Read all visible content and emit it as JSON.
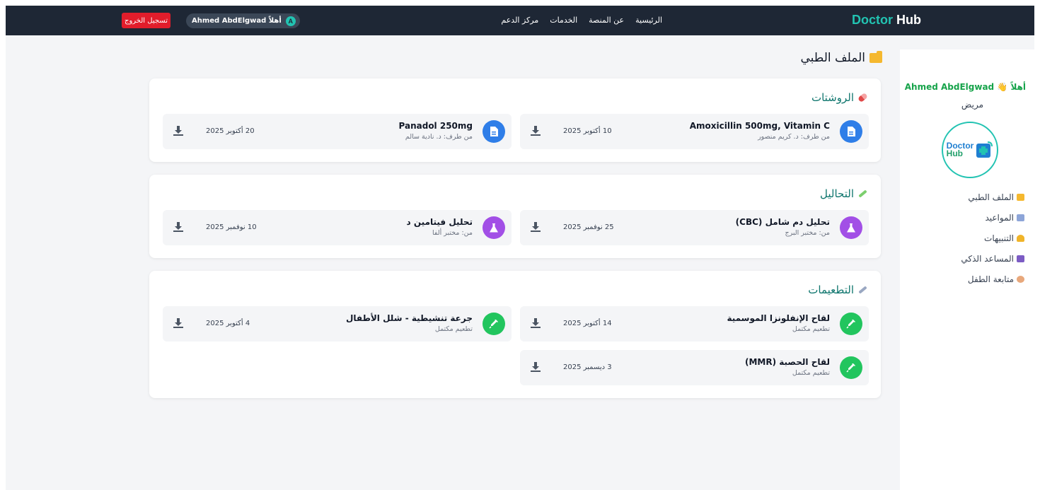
{
  "navbar": {
    "brand_part1": "Doctor",
    "brand_part2": "Hub",
    "links": [
      "الرئيسية",
      "عن المنصة",
      "الخدمات",
      "مركز الدعم"
    ],
    "user_greeting": "أهلاً Ahmed AbdElgwad",
    "avatar_letter": "A",
    "logout_label": "تسجيل الخروج"
  },
  "sidebar": {
    "greeting": "أهلاً 👋 Ahmed AbdElgwad",
    "role": "مريض",
    "logo_line1": "Doctor",
    "logo_line2": "Hub",
    "menu": [
      {
        "label": "الملف الطبي",
        "icon": "folder-icon",
        "color": "#f5b82e"
      },
      {
        "label": "المواعيد",
        "icon": "calendar-icon",
        "color": "#8da5d8"
      },
      {
        "label": "التنبيهات",
        "icon": "bell-icon",
        "color": "#f0b429"
      },
      {
        "label": "المساعد الذكي",
        "icon": "robot-icon",
        "color": "#7c5cc4"
      },
      {
        "label": "متابعة الطفل",
        "icon": "baby-icon",
        "color": "#e8a87c"
      }
    ]
  },
  "page": {
    "title": "الملف الطبي"
  },
  "sections": {
    "prescriptions": {
      "title": "الروشتات",
      "items": [
        {
          "name": "Amoxicillin 500mg, Vitamin C",
          "sub": "من طرف: د. كريم منصور",
          "date": "10 أكتوبر 2025"
        },
        {
          "name": "Panadol 250mg",
          "sub": "من طرف: د. نادية سالم",
          "date": "20 أكتوبر 2025"
        }
      ]
    },
    "tests": {
      "title": "التحاليل",
      "items": [
        {
          "name": "تحليل دم شامل (CBC)",
          "sub": "من: مختبر البرج",
          "date": "25 نوفمبر 2025"
        },
        {
          "name": "تحليل فيتامين د",
          "sub": "من: مختبر ألفا",
          "date": "10 نوفمبر 2025"
        }
      ]
    },
    "vaccines": {
      "title": "التطعيمات",
      "items": [
        {
          "name": "لقاح الإنفلونزا الموسمية",
          "sub": "تطعيم مكتمل",
          "date": "14 أكتوبر 2025"
        },
        {
          "name": "جرعة تنشيطية - شلل الأطفال",
          "sub": "تطعيم مكتمل",
          "date": "4 أكتوبر 2025"
        },
        {
          "name": "لقاح الحصبة (MMR)",
          "sub": "تطعيم مكتمل",
          "date": "3 ديسمبر 2025"
        }
      ]
    }
  },
  "colors": {
    "navbar_bg": "#1e2735",
    "accent_teal": "#22c3b2",
    "prescription_blue": "#2f7ee8",
    "test_purple": "#a24fe6",
    "vaccine_green": "#22c55e",
    "logout_red": "#e11d2b"
  }
}
